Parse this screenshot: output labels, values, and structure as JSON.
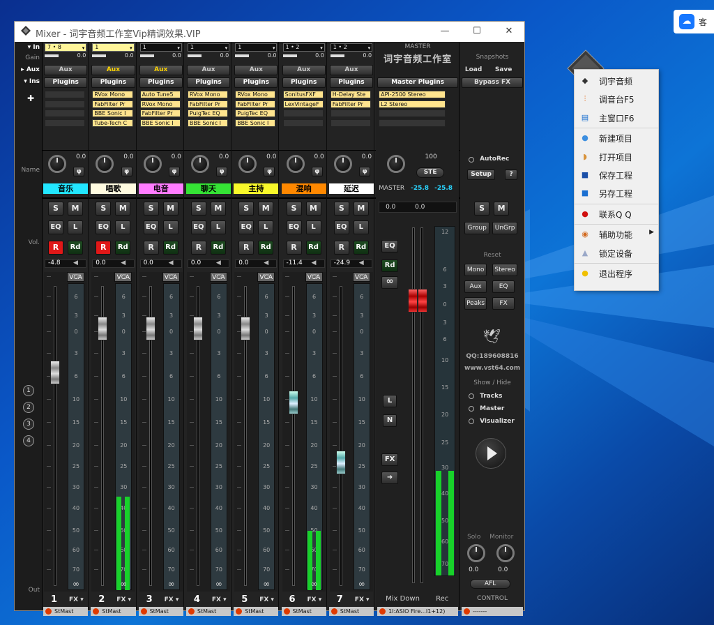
{
  "desktop": {
    "taskbar_app_glyph": "☁",
    "taskbar_app_label": "客"
  },
  "window": {
    "title": "Mixer - 词宇音频工作室Vip精调效果.VIP",
    "minimize": "—",
    "maximize": "☐",
    "close": "✕"
  },
  "left_labels": {
    "in": "In",
    "gain": "Gain",
    "aux": "Aux",
    "ins": "Ins",
    "name": "Name",
    "vol": "Vol.",
    "out": "Out"
  },
  "channels": [
    {
      "num": "1",
      "input": "7 • 8",
      "input_hl": true,
      "gain": "0.0",
      "aux": "Aux",
      "aux_hl": false,
      "plugins": [],
      "pan": "0.0",
      "name": "音乐",
      "name_color": "#22e6ff",
      "rec": "R",
      "rec_on": true,
      "rd": "Rd",
      "vol": "-4.8",
      "level": 0,
      "out": "StMast"
    },
    {
      "num": "2",
      "input": "1",
      "input_hl": true,
      "gain": "0.0",
      "aux": "Aux",
      "aux_hl": true,
      "plugins": [
        "RVox Mono",
        "FabFilter Pr",
        "BBE Sonic I",
        "Tube-Tech C"
      ],
      "pan": "0.0",
      "name": "唱歌",
      "name_color": "#fffbe0",
      "rec": "R",
      "rec_on": true,
      "rd": "Rd",
      "vol": "0.0",
      "level": 0.49,
      "out": "StMast"
    },
    {
      "num": "3",
      "input": "1",
      "input_hl": false,
      "gain": "0.0",
      "aux": "Aux",
      "aux_hl": true,
      "plugins": [
        "Auto Tune5",
        "RVox Mono",
        "FabFilter Pr",
        "BBE Sonic I"
      ],
      "pan": "0.0",
      "name": "电音",
      "name_color": "#ff7cff",
      "rec": "R",
      "rec_on": false,
      "rd": "Rd",
      "vol": "0.0",
      "level": 0,
      "out": "StMast"
    },
    {
      "num": "4",
      "input": "1",
      "input_hl": false,
      "gain": "0.0",
      "aux": "Aux",
      "aux_hl": false,
      "plugins": [
        "RVox Mono",
        "FabFilter Pr",
        "PuigTec EQ",
        "BBE Sonic I"
      ],
      "pan": "0.0",
      "name": "聊天",
      "name_color": "#35e335",
      "rec": "R",
      "rec_on": false,
      "rd": "Rd",
      "vol": "0.0",
      "level": 0,
      "out": "StMast"
    },
    {
      "num": "5",
      "input": "1",
      "input_hl": false,
      "gain": "0.0",
      "aux": "Aux",
      "aux_hl": false,
      "plugins": [
        "RVox Mono",
        "FabFilter Pr",
        "PuigTec EQ",
        "BBE Sonic I"
      ],
      "pan": "0.0",
      "name": "主持",
      "name_color": "#f8f82a",
      "rec": "R",
      "rec_on": false,
      "rd": "Rd",
      "vol": "0.0",
      "level": 0,
      "out": "StMast"
    },
    {
      "num": "6",
      "input": "1 • 2",
      "input_hl": false,
      "gain": "0.0",
      "aux": "Aux",
      "aux_hl": false,
      "plugins": [
        "SonitusFXF",
        "LexVintageF"
      ],
      "pan": "0.0",
      "name": "混响",
      "name_color": "#ff8800",
      "rec": "R",
      "rec_on": false,
      "rd": "Rd",
      "vol": "-11.4",
      "level": 0.31,
      "out": "StMast"
    },
    {
      "num": "7",
      "input": "1 • 2",
      "input_hl": false,
      "gain": "0.0",
      "aux": "Aux",
      "aux_hl": false,
      "plugins": [
        "H-Delay Ste",
        "FabFilter Pr"
      ],
      "pan": "0.0",
      "name": "延迟",
      "name_color": "#ffffff",
      "rec": "R",
      "rec_on": false,
      "rd": "Rd",
      "vol": "-24.9",
      "level": 0,
      "out": "StMast"
    }
  ],
  "strip_buttons": {
    "s": "S",
    "m": "M",
    "eq": "EQ",
    "l": "L",
    "phase": "φ",
    "vca": "VCA",
    "link": "∞",
    "fx": "FX ▾"
  },
  "fader_scale": [
    "12",
    "6",
    "3",
    "0",
    "3",
    "6",
    "10",
    "15",
    "20",
    "25",
    "30",
    "40",
    "50",
    "60",
    "70"
  ],
  "master": {
    "header": "MASTER",
    "brand": "词宇音频工作室",
    "plugins_label": "Master Plugins",
    "plugins": [
      "API-2500 Stereo",
      "L2 Stereo"
    ],
    "width": "100",
    "ste": "STE",
    "name": "MASTER",
    "peak_l": "-25.8",
    "peak_r": "-25.8",
    "vol_l": "0.0",
    "vol_r": "0.0",
    "eq": "EQ",
    "rd": "Rd",
    "link": "∞",
    "l": "L",
    "n": "N",
    "fx": "FX",
    "arrow": "➜",
    "mixdown": "Mix Down",
    "rec": "Rec",
    "out": "1I:ASIO Fire...I1+12)",
    "meter_scale": [
      "12",
      "6",
      "3",
      "0",
      "3",
      "6",
      "10",
      "15",
      "20",
      "25",
      "30",
      "40",
      "50",
      "60",
      "70"
    ]
  },
  "side": {
    "snapshots": "Snapshots",
    "load": "Load",
    "save": "Save",
    "bypass": "Bypass FX",
    "autorec": "AutoRec",
    "setup": "Setup",
    "help": "?",
    "s": "S",
    "m": "M",
    "group": "Group",
    "ungrp": "UnGrp",
    "reset": "Reset",
    "mono": "Mono",
    "stereo": "Stereo",
    "aux": "Aux",
    "eq": "EQ",
    "peaks": "Peaks",
    "fx": "FX",
    "qq": "QQ:189608816",
    "site": "www.vst64.com",
    "showhide": "Show / Hide",
    "tracks": "Tracks",
    "master": "Master",
    "visualizer": "Visualizer",
    "solo": "Solo",
    "monitor": "Monitor",
    "solo_val": "0.0",
    "mon_val": "0.0",
    "afl": "AFL",
    "control": "CONTROL",
    "out": "-------"
  },
  "groups": [
    "1",
    "2",
    "3",
    "4"
  ],
  "context_menu": [
    {
      "label": "词宇音频",
      "icon": "mixer-icon",
      "glyph": "◆",
      "color": "#333"
    },
    {
      "label": "调音台F5",
      "icon": "sliders-icon",
      "glyph": "⫶",
      "color": "#e05a00"
    },
    {
      "label": "主窗口F6",
      "icon": "window-icon",
      "glyph": "▤",
      "color": "#1a6fd1"
    },
    {
      "sep": true
    },
    {
      "label": "新建项目",
      "icon": "new-project-icon",
      "glyph": "●",
      "color": "#3d8fe0"
    },
    {
      "label": "打开项目",
      "icon": "open-project-icon",
      "glyph": "◗",
      "color": "#d8923a"
    },
    {
      "label": "保存工程",
      "icon": "save-icon",
      "glyph": "■",
      "color": "#1a4fa8"
    },
    {
      "label": "另存工程",
      "icon": "save-as-icon",
      "glyph": "■",
      "color": "#1a6fd1"
    },
    {
      "sep": true
    },
    {
      "label": "联系Q Q",
      "icon": "qq-icon",
      "glyph": "●",
      "color": "#d01010"
    },
    {
      "sep": true
    },
    {
      "label": "辅助功能",
      "icon": "tools-icon",
      "glyph": "◉",
      "color": "#d2691e",
      "sub": true
    },
    {
      "label": "锁定设备",
      "icon": "lock-icon",
      "glyph": "▲",
      "color": "#9aa8c8"
    },
    {
      "sep": true
    },
    {
      "label": "退出程序",
      "icon": "exit-icon",
      "glyph": "●",
      "color": "#f0c000"
    }
  ]
}
